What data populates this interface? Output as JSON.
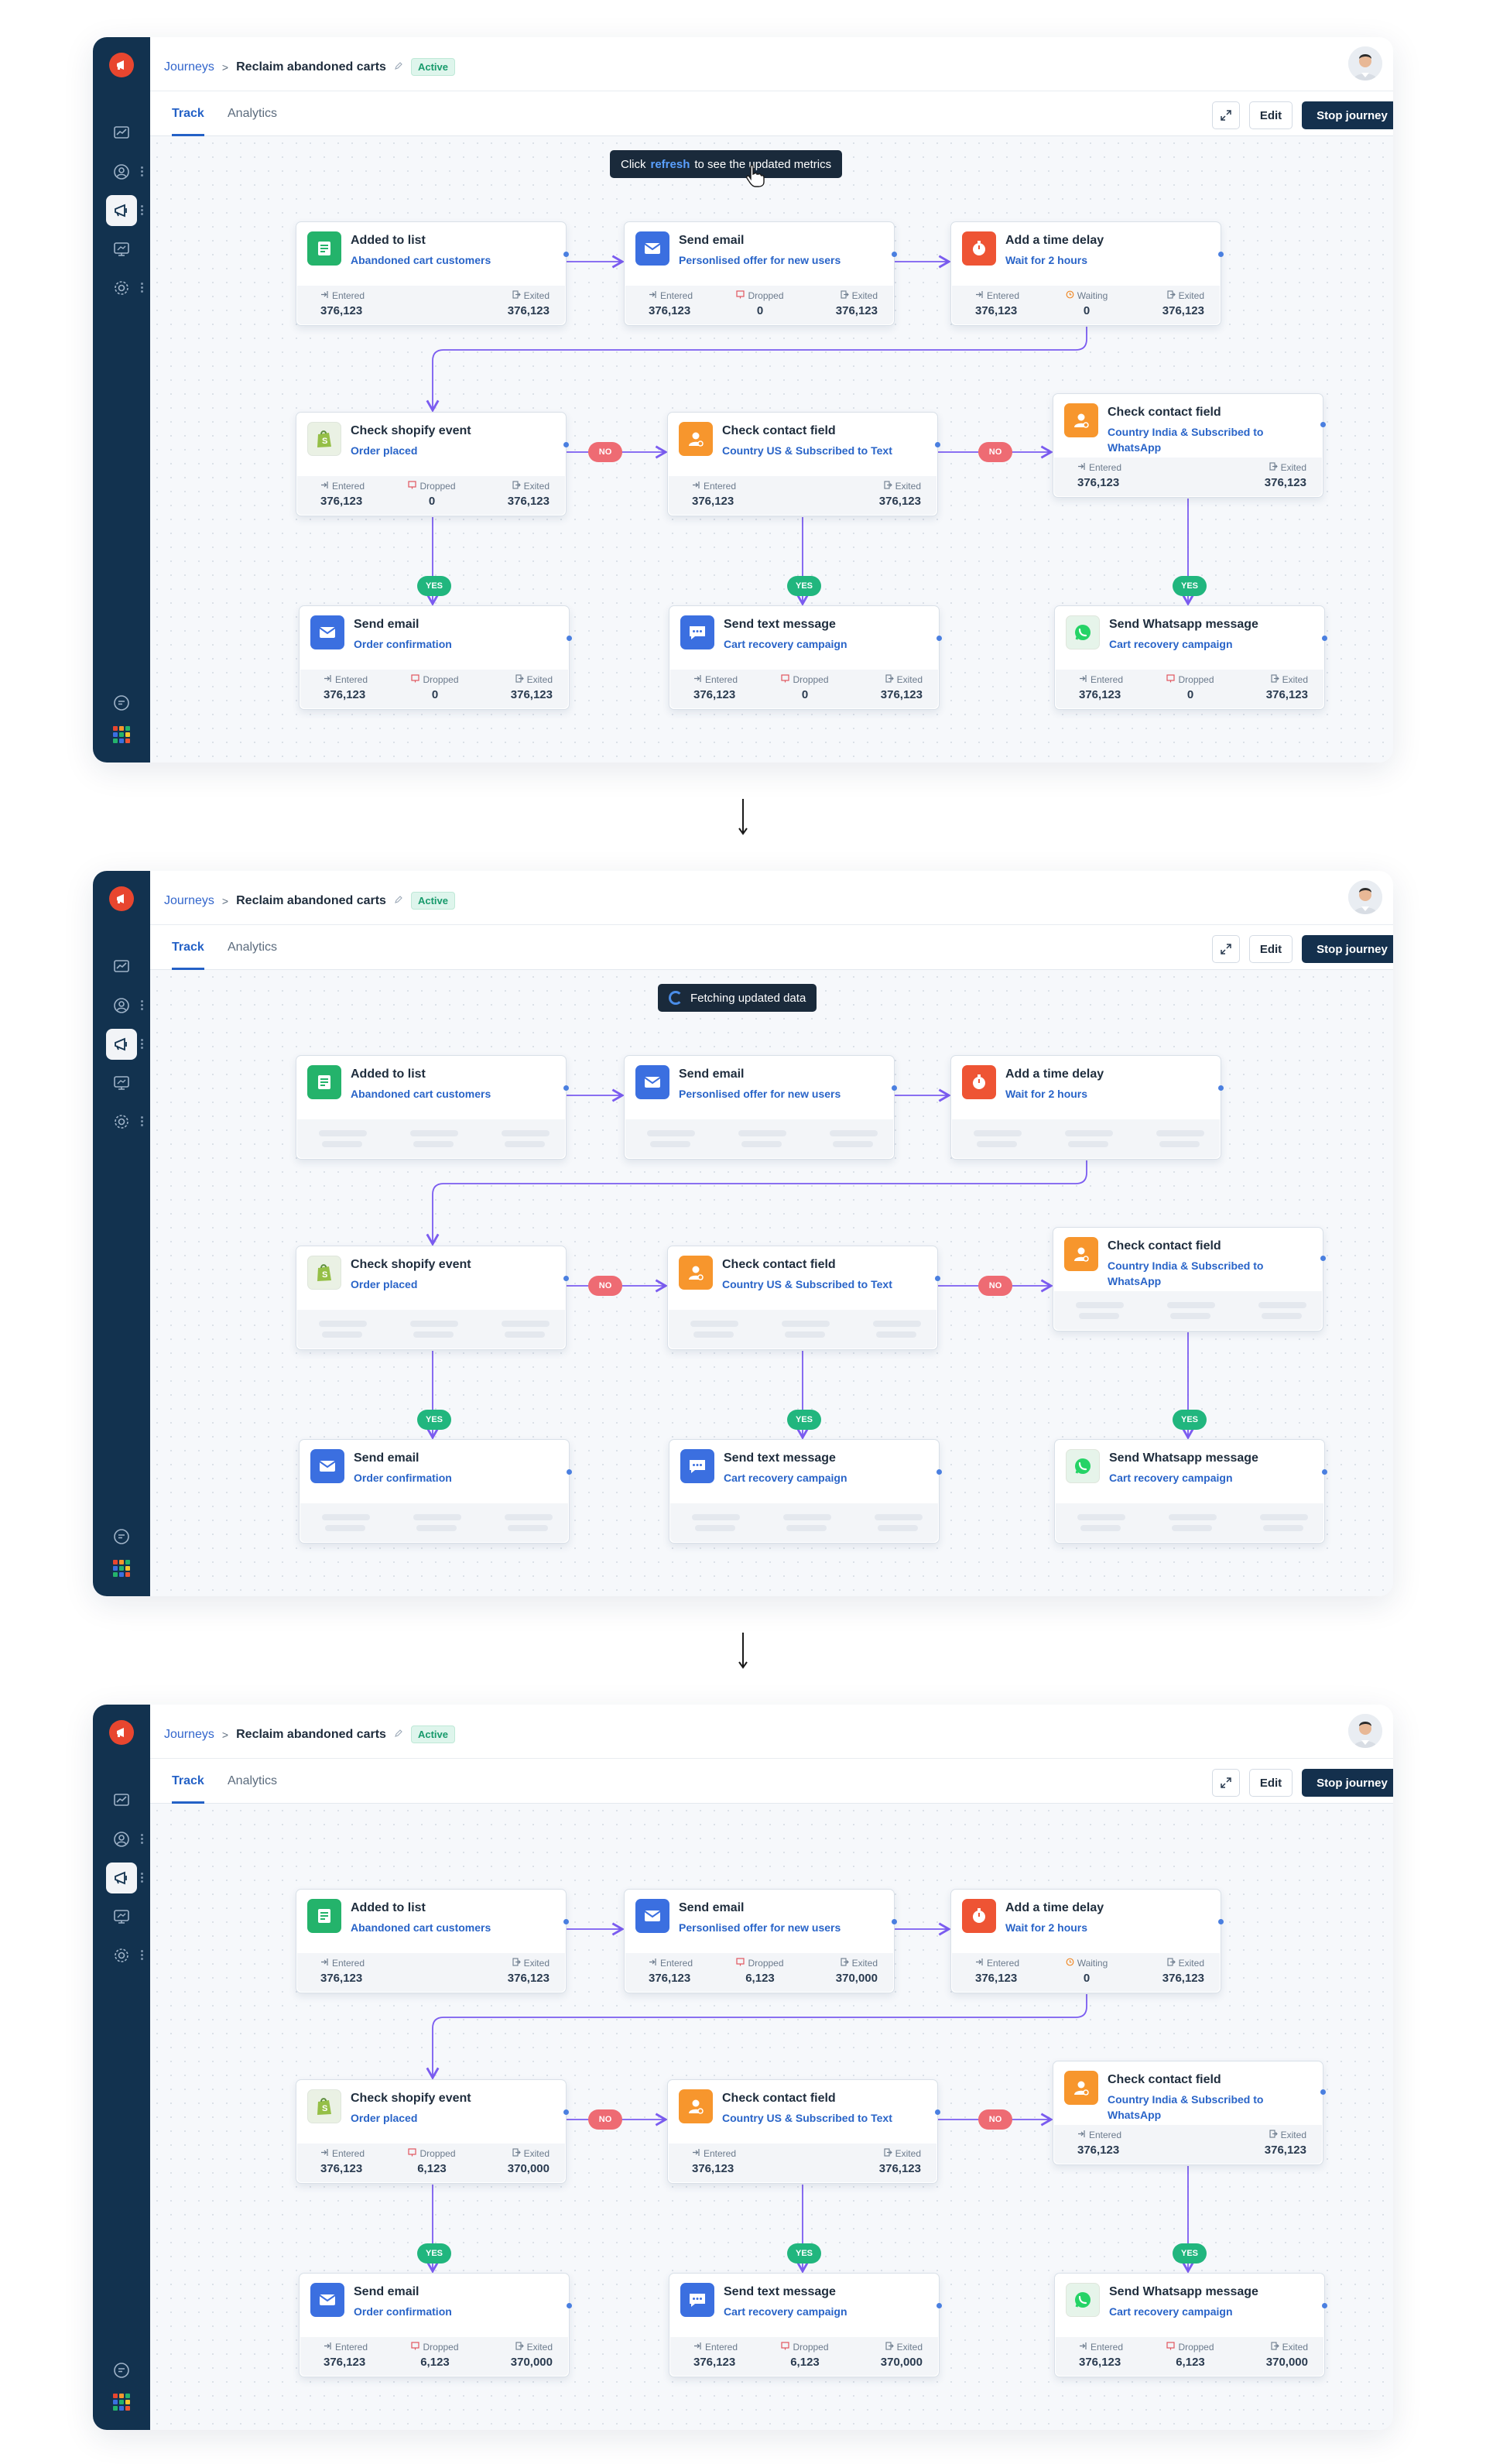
{
  "breadcrumb": {
    "root": "Journeys",
    "separator": ">",
    "title": "Reclaim abandoned carts",
    "status": "Active"
  },
  "tabs": [
    "Track",
    "Analytics"
  ],
  "toolbar": {
    "edit": "Edit",
    "stop": "Stop journey",
    "more": "⋮"
  },
  "toasts": {
    "refresh": {
      "before": "Click ",
      "link": "refresh",
      "after": " to see the updated metrics"
    },
    "fetching": "Fetching updated data"
  },
  "connectors": {
    "no": "NO",
    "yes": "YES"
  },
  "stat_labels": {
    "entered": "Entered",
    "dropped": "Dropped",
    "exited": "Exited",
    "waiting": "Waiting"
  },
  "colors": {
    "sidebar": "#12324f",
    "accent": "#2461c6",
    "active_badge": "#179a6b",
    "no": "#ee6b73",
    "yes": "#21b67e"
  },
  "nodes": [
    {
      "id": "added",
      "title": "Added to list",
      "subtitle": "Abandoned cart customers",
      "icon": "list-icon",
      "color": "#24b36b"
    },
    {
      "id": "email1",
      "title": "Send email",
      "subtitle": "Personlised offer for new users",
      "icon": "email-icon",
      "color": "#3b6fe0"
    },
    {
      "id": "delay",
      "title": "Add a time delay",
      "subtitle": "Wait for 2 hours",
      "icon": "timer-icon",
      "color": "#ee5434"
    },
    {
      "id": "shopify",
      "title": "Check shopify event",
      "subtitle": "Order placed",
      "icon": "shopify-icon",
      "color": "#eaf1e4"
    },
    {
      "id": "contact1",
      "title": "Check contact field",
      "subtitle": "Country US & Subscribed to Text",
      "icon": "contact-icon",
      "color": "#f7962d"
    },
    {
      "id": "contact2",
      "title": "Check contact field",
      "subtitle": "Country India & Subscribed to WhatsApp",
      "icon": "contact-icon",
      "color": "#f7962d"
    },
    {
      "id": "email2",
      "title": "Send email",
      "subtitle": "Order confirmation",
      "icon": "email-icon",
      "color": "#3b6fe0"
    },
    {
      "id": "text",
      "title": "Send text message",
      "subtitle": "Cart recovery campaign",
      "icon": "chat-icon",
      "color": "#3b6fe0"
    },
    {
      "id": "whatsapp",
      "title": "Send Whatsapp message",
      "subtitle": "Cart recovery campaign",
      "icon": "whatsapp-icon",
      "color": "#e6f4ea"
    }
  ],
  "panels": [
    {
      "toast": "refresh",
      "stats": {
        "added": [
          [
            "entered",
            "376,123"
          ],
          [
            "exited",
            "376,123"
          ]
        ],
        "email1": [
          [
            "entered",
            "376,123"
          ],
          [
            "dropped",
            "0"
          ],
          [
            "exited",
            "376,123"
          ]
        ],
        "delay": [
          [
            "entered",
            "376,123"
          ],
          [
            "waiting",
            "0"
          ],
          [
            "exited",
            "376,123"
          ]
        ],
        "shopify": [
          [
            "entered",
            "376,123"
          ],
          [
            "dropped",
            "0"
          ],
          [
            "exited",
            "376,123"
          ]
        ],
        "contact1": [
          [
            "entered",
            "376,123"
          ],
          [
            "exited",
            "376,123"
          ]
        ],
        "contact2": [
          [
            "entered",
            "376,123"
          ],
          [
            "exited",
            "376,123"
          ]
        ],
        "email2": [
          [
            "entered",
            "376,123"
          ],
          [
            "dropped",
            "0"
          ],
          [
            "exited",
            "376,123"
          ]
        ],
        "text": [
          [
            "entered",
            "376,123"
          ],
          [
            "dropped",
            "0"
          ],
          [
            "exited",
            "376,123"
          ]
        ],
        "whatsapp": [
          [
            "entered",
            "376,123"
          ],
          [
            "dropped",
            "0"
          ],
          [
            "exited",
            "376,123"
          ]
        ]
      }
    },
    {
      "toast": "fetching",
      "stats": null
    },
    {
      "toast": null,
      "stats": {
        "added": [
          [
            "entered",
            "376,123"
          ],
          [
            "exited",
            "376,123"
          ]
        ],
        "email1": [
          [
            "entered",
            "376,123"
          ],
          [
            "dropped",
            "6,123"
          ],
          [
            "exited",
            "370,000"
          ]
        ],
        "delay": [
          [
            "entered",
            "376,123"
          ],
          [
            "waiting",
            "0"
          ],
          [
            "exited",
            "376,123"
          ]
        ],
        "shopify": [
          [
            "entered",
            "376,123"
          ],
          [
            "dropped",
            "6,123"
          ],
          [
            "exited",
            "370,000"
          ]
        ],
        "contact1": [
          [
            "entered",
            "376,123"
          ],
          [
            "exited",
            "376,123"
          ]
        ],
        "contact2": [
          [
            "entered",
            "376,123"
          ],
          [
            "exited",
            "376,123"
          ]
        ],
        "email2": [
          [
            "entered",
            "376,123"
          ],
          [
            "dropped",
            "6,123"
          ],
          [
            "exited",
            "370,000"
          ]
        ],
        "text": [
          [
            "entered",
            "376,123"
          ],
          [
            "dropped",
            "6,123"
          ],
          [
            "exited",
            "370,000"
          ]
        ],
        "whatsapp": [
          [
            "entered",
            "376,123"
          ],
          [
            "dropped",
            "6,123"
          ],
          [
            "exited",
            "370,000"
          ]
        ]
      }
    }
  ]
}
